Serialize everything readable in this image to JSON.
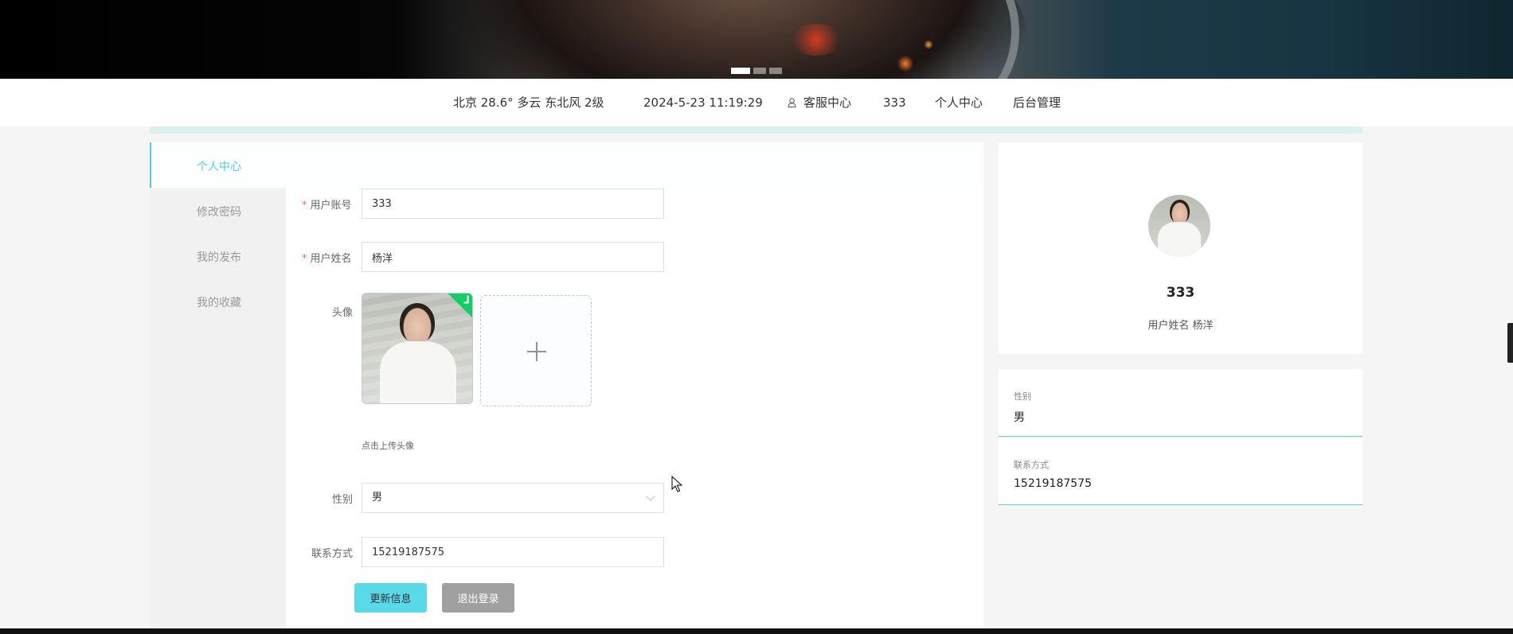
{
  "topnav": {
    "weather": "北京  28.6°  多云  东北风  2级",
    "datetime": "2024-5-23 11:19:29",
    "service": "客服中心",
    "username": "333",
    "personal_center": "个人中心",
    "admin": "后台管理"
  },
  "tab": {
    "title": "个人中心"
  },
  "sidemenu": {
    "items": [
      {
        "label": "修改密码"
      },
      {
        "label": "我的发布"
      },
      {
        "label": "我的收藏"
      }
    ]
  },
  "form": {
    "account_label": "用户账号",
    "account_value": "333",
    "name_label": "用户姓名",
    "name_value": "杨洋",
    "avatar_label": "头像",
    "upload_hint": "点击上传头像",
    "gender_label": "性别",
    "gender_value": "男",
    "phone_label": "联系方式",
    "phone_value": "15219187575",
    "update_button": "更新信息",
    "logout_button": "退出登录"
  },
  "profile": {
    "username": "333",
    "realname": "用户姓名 杨洋",
    "gender_label": "性别",
    "gender_value": "男",
    "phone_label": "联系方式",
    "phone_value": "15219187575"
  },
  "colors": {
    "accent": "#4dd0dd",
    "update_button": "#59dae8",
    "logout_button": "#a0a0a0",
    "required": "#f56c6c",
    "success_badge": "#13ce66"
  },
  "icons": [
    "user-icon",
    "plus-icon",
    "check-icon",
    "chevron-down-icon",
    "cursor-icon"
  ]
}
